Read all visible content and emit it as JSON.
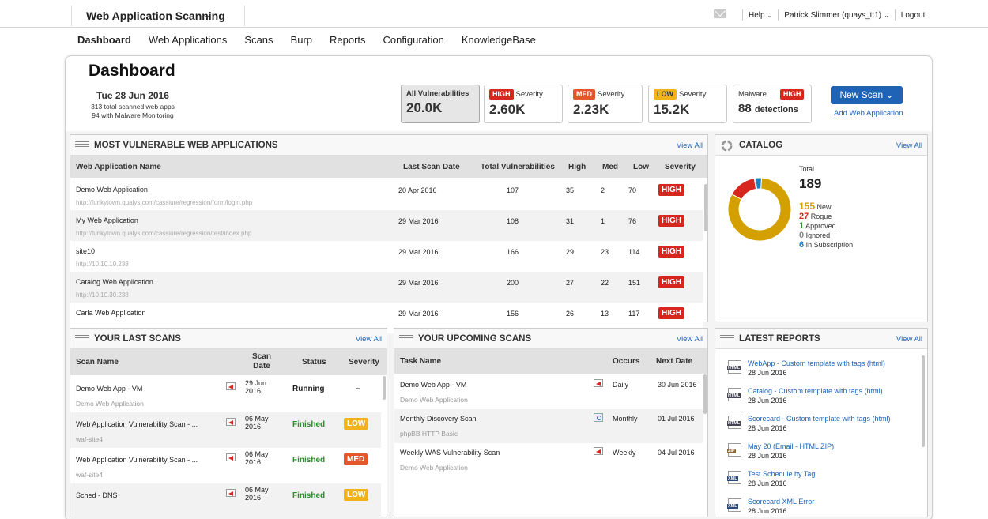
{
  "topbar": {
    "app_title": "Web Application Scanning",
    "help": "Help",
    "user": "Patrick Slimmer (quays_tt1)",
    "logout": "Logout"
  },
  "nav": [
    "Dashboard",
    "Web Applications",
    "Scans",
    "Burp",
    "Reports",
    "Configuration",
    "KnowledgeBase"
  ],
  "dashboard": {
    "title": "Dashboard",
    "date": "Tue 28 Jun 2016",
    "sub1": "313 total scanned web apps",
    "sub2": "94 with Malware Monitoring",
    "stats": {
      "all_label": "All Vulnerabilities",
      "all_value": "20.0K",
      "high_badge": "HIGH",
      "high_label": "Severity",
      "high_value": "2.60K",
      "med_badge": "MED",
      "med_label": "Severity",
      "med_value": "2.23K",
      "low_badge": "LOW",
      "low_label": "Severity",
      "low_value": "15.2K",
      "mal_label": "Malware",
      "mal_badge": "HIGH",
      "mal_value": "88",
      "mal_unit": "detections"
    },
    "new_scan": "New Scan",
    "add_web": "Add Web Application"
  },
  "most_vuln": {
    "title": "MOST VULNERABLE WEB APPLICATIONS",
    "view_all": "View All",
    "headers": [
      "Web Application Name",
      "Last Scan Date",
      "Total Vulnerabilities",
      "High",
      "Med",
      "Low",
      "Severity"
    ],
    "rows": [
      {
        "name": "Demo Web Application",
        "url": "http://funkytown.qualys.com/cassiure/regression/form/login.php",
        "date": "20 Apr 2016",
        "total": "107",
        "high": "35",
        "med": "2",
        "low": "70",
        "sev": "HIGH"
      },
      {
        "name": "My Web Application",
        "url": "http://funkytown.qualys.com/cassiure/regression/test/index.php",
        "date": "29 Mar 2016",
        "total": "108",
        "high": "31",
        "med": "1",
        "low": "76",
        "sev": "HIGH"
      },
      {
        "name": "site10",
        "url": "http://10.10.10.238",
        "date": "29 Mar 2016",
        "total": "166",
        "high": "29",
        "med": "23",
        "low": "114",
        "sev": "HIGH"
      },
      {
        "name": "Catalog Web Application",
        "url": "http://10.10.30.238",
        "date": "29 Mar 2016",
        "total": "200",
        "high": "27",
        "med": "22",
        "low": "151",
        "sev": "HIGH"
      },
      {
        "name": "Carla Web Application",
        "url": "",
        "date": "29 Mar 2016",
        "total": "156",
        "high": "26",
        "med": "13",
        "low": "117",
        "sev": "HIGH"
      }
    ]
  },
  "catalog": {
    "title": "CATALOG",
    "view_all": "View All",
    "total_label": "Total",
    "total": "189",
    "items": [
      {
        "value": "155",
        "label": "New",
        "color": "#d4a000"
      },
      {
        "value": "27",
        "label": "Rogue",
        "color": "#d7261e"
      },
      {
        "value": "1",
        "label": "Approved",
        "color": "#2e8b2e"
      },
      {
        "value": "0",
        "label": "Ignored",
        "color": "#888888"
      },
      {
        "value": "6",
        "label": "In Subscription",
        "color": "#1e7ec8"
      }
    ]
  },
  "last_scans": {
    "title": "YOUR LAST SCANS",
    "view_all": "View All",
    "headers": {
      "name": "Scan Name",
      "date1": "Scan",
      "date2": "Date",
      "status": "Status",
      "sev": "Severity"
    },
    "rows": [
      {
        "name": "Demo Web App - VM",
        "sub": "Demo Web Application",
        "d1": "29 Jun",
        "d2": "2016",
        "status": "Running",
        "sev": "–"
      },
      {
        "name": "Web Application Vulnerability Scan - ...",
        "sub": "waf-site4",
        "d1": "06 May",
        "d2": "2016",
        "status": "Finished",
        "sev": "LOW"
      },
      {
        "name": "Web Application Vulnerability Scan - ...",
        "sub": "waf-site4",
        "d1": "06 May",
        "d2": "2016",
        "status": "Finished",
        "sev": "MED"
      },
      {
        "name": "Sched - DNS",
        "sub": "",
        "d1": "06 May",
        "d2": "2016",
        "status": "Finished",
        "sev": "LOW"
      }
    ]
  },
  "upcoming": {
    "title": "YOUR UPCOMING SCANS",
    "view_all": "View All",
    "headers": {
      "name": "Task Name",
      "occurs": "Occurs",
      "next": "Next Date"
    },
    "rows": [
      {
        "name": "Demo Web App - VM",
        "sub": "Demo Web Application",
        "occurs": "Daily",
        "next": "30 Jun 2016"
      },
      {
        "name": "Monthly Discovery Scan",
        "sub": "phpBB HTTP Basic",
        "occurs": "Monthly",
        "next": "01 Jul 2016"
      },
      {
        "name": "Weekly WAS Vulnerability Scan",
        "sub": "Demo Web Application",
        "occurs": "Weekly",
        "next": "04 Jul 2016"
      }
    ]
  },
  "reports": {
    "title": "LATEST REPORTS",
    "view_all": "View All",
    "items": [
      {
        "type": "HTML",
        "name": "WebApp - Custom template with tags (html)",
        "date": "28 Jun 2016"
      },
      {
        "type": "HTML",
        "name": "Catalog - Custom template with tags (html)",
        "date": "28 Jun 2016"
      },
      {
        "type": "HTML",
        "name": "Scorecard - Custom template with tags (html)",
        "date": "28 Jun 2016"
      },
      {
        "type": "ZIP",
        "name": "May 20 (Email - HTML ZIP)",
        "date": "28 Jun 2016"
      },
      {
        "type": "XML",
        "name": "Test Schedule by Tag",
        "date": "28 Jun 2016"
      },
      {
        "type": "XML",
        "name": "Scorecard XML Error",
        "date": "28 Jun 2016"
      }
    ]
  },
  "colors": {
    "high": "#d7261e",
    "med": "#e4572c",
    "low": "#f2b21b",
    "link": "#1e63b5",
    "finished": "#2e8b2e"
  }
}
